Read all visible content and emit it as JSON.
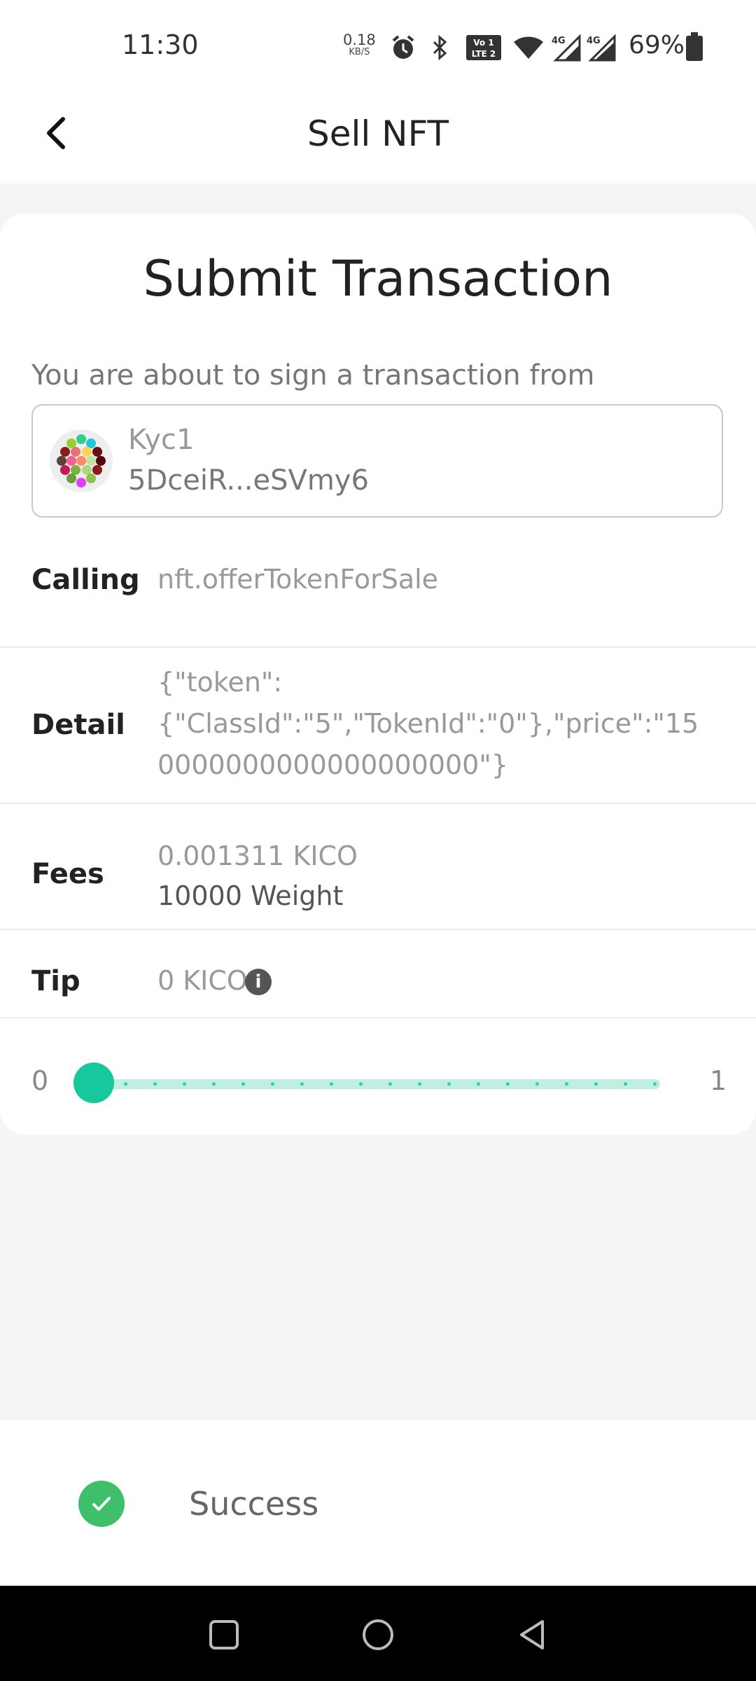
{
  "status_bar": {
    "time": "11:30",
    "net_speed_value": "0.18",
    "net_speed_unit": "KB/S",
    "volte_label": "Vo LTE 2",
    "network_4g_1": "4G",
    "network_4g_2": "4G",
    "battery": "69%"
  },
  "header": {
    "title": "Sell NFT"
  },
  "card": {
    "title": "Submit Transaction",
    "intro": "You are about to sign a transaction from",
    "account": {
      "name": "Kyc1",
      "address": "5DceiR...eSVmy6"
    },
    "rows": {
      "calling_label": "Calling",
      "calling_value": "nft.offerTokenForSale",
      "detail_label": "Detail",
      "detail_value": "{\"token\":\n{\"ClassId\":\"5\",\"TokenId\":\"0\"},\"price\":\"15\n0000000000000000000\"}",
      "fees_label": "Fees",
      "fees_amount": "0.001311 KICO",
      "fees_weight": "10000 Weight",
      "tip_label": "Tip",
      "tip_value": "0 KICO",
      "tip_info_glyph": "i"
    },
    "tip_slider": {
      "min_label": "0",
      "max_label": "1",
      "value": 0
    }
  },
  "toast": {
    "message": "Success",
    "icon": "check-circle-icon"
  },
  "nav_bar": {
    "icons": [
      "recents-icon",
      "home-icon",
      "back-icon"
    ]
  },
  "colors": {
    "accent": "#17c79e",
    "success": "#3fbf6a",
    "slider_track": "#bfeee3"
  }
}
